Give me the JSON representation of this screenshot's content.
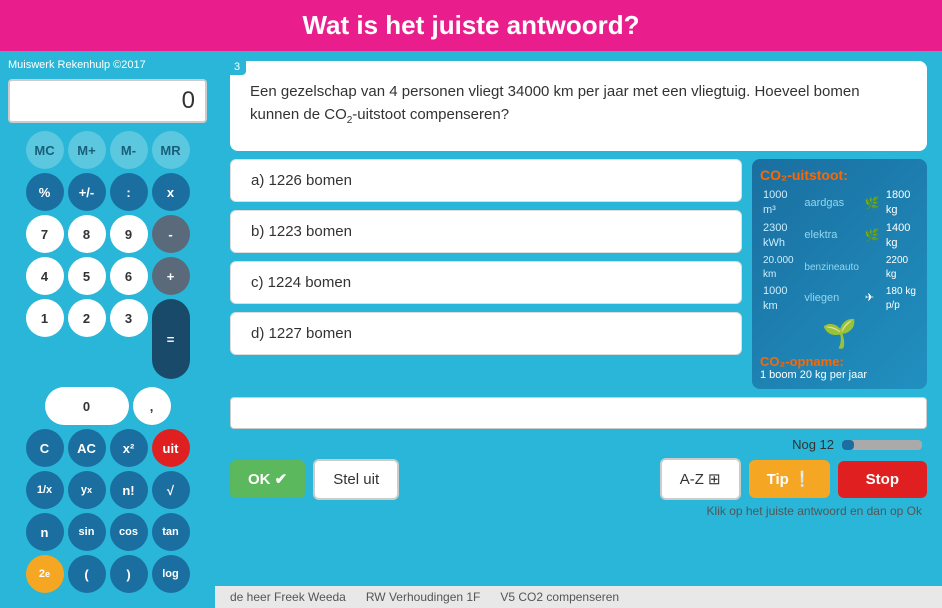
{
  "header": {
    "title": "Wat is het juiste antwoord?"
  },
  "calculator": {
    "title": "Muiswerk Rekenhulp ©2017",
    "display_value": "0",
    "buttons": {
      "row1": [
        "MC",
        "M+",
        "M-",
        "MR"
      ],
      "row2": [
        "%",
        "+/-",
        ":",
        "x"
      ],
      "row3": [
        "7",
        "8",
        "9",
        "-"
      ],
      "row4": [
        "4",
        "5",
        "6",
        "+"
      ],
      "row5": [
        "1",
        "2",
        "3"
      ],
      "row6": [
        "0",
        ","
      ],
      "row7": [
        "C",
        "AC",
        "x²",
        "uit"
      ],
      "row8": [
        "1/x",
        "yˣ",
        "n!",
        "√"
      ],
      "row9": [
        "n",
        "sin",
        "cos",
        "tan"
      ],
      "row10": [
        "2ᵉ",
        "(",
        ")",
        "log"
      ],
      "equals": "="
    }
  },
  "question": {
    "number": "3",
    "text": "Een gezelschap van 4 personen vliegt 34000 km per jaar met een vliegtuig. Hoeveel bomen kunnen de CO₂-uitstoot compenseren?"
  },
  "answers": [
    {
      "id": "a",
      "label": "a) 1226 bomen"
    },
    {
      "id": "b",
      "label": "b) 1223 bomen"
    },
    {
      "id": "c",
      "label": "c) 1224 bomen"
    },
    {
      "id": "d",
      "label": "d) 1227 bomen"
    }
  ],
  "co2_info": {
    "title": "CO₂-uitstoot:",
    "rows": [
      {
        "amount": "1000 m³",
        "category": "aardgas",
        "value": "1800 kg"
      },
      {
        "amount": "2300 kWh",
        "category": "elektra",
        "value": "1400 kg"
      },
      {
        "amount": "20.000 km",
        "category": "benzineauto",
        "value": "2200 kg"
      },
      {
        "amount": "1000 km",
        "category": "vliegen",
        "value": "180 kg p/p"
      }
    ],
    "opname_title": "CO₂-opname:",
    "opname_text": "1 boom 20 kg per jaar"
  },
  "controls": {
    "ok_label": "OK ✔",
    "steluit_label": "Stel uit",
    "az_label": "A-Z ⊞",
    "tip_label": "Tip ❕",
    "stop_label": "Stop",
    "progress_label": "Nog 12",
    "hint_text": "Klik op het juiste antwoord en dan op Ok"
  },
  "footer": {
    "teacher": "de heer Freek Weeda",
    "course": "RW Verhoudingen 1F",
    "lesson": "V5 CO2 compenseren"
  }
}
